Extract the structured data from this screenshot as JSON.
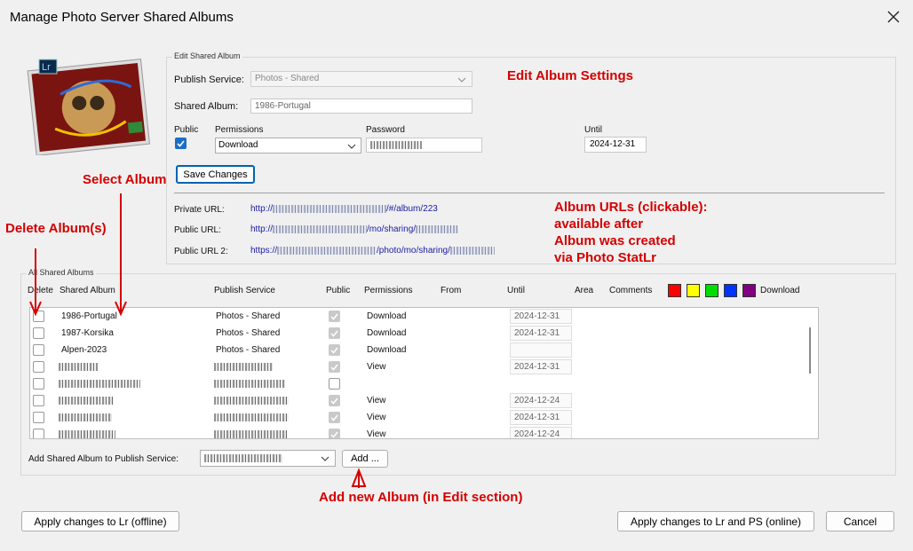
{
  "window": {
    "title": "Manage Photo Server Shared Albums"
  },
  "edit": {
    "legend": "Edit Shared Album",
    "publish_service_label": "Publish Service:",
    "publish_service_value": "Photos - Shared",
    "shared_album_label": "Shared Album:",
    "shared_album_value": "1986-Portugal",
    "public_label": "Public",
    "permissions_label": "Permissions",
    "permissions_value": "Download",
    "password_label": "Password",
    "until_label": "Until",
    "until_value": "2024-12-31",
    "save_label": "Save Changes",
    "private_url_label": "Private URL:",
    "private_url_prefix": "http://",
    "private_url_suffix": "/#/album/223",
    "public_url_label": "Public URL:",
    "public_url_prefix": "http://",
    "public_url_mid": "/mo/sharing/",
    "public_url2_label": "Public URL 2:",
    "public_url2_prefix": "https://",
    "public_url2_mid": "/photo/mo/sharing/"
  },
  "list": {
    "legend": "All Shared Albums",
    "headers": {
      "delete": "Delete",
      "album": "Shared Album",
      "service": "Publish Service",
      "public": "Public",
      "permissions": "Permissions",
      "from": "From",
      "until": "Until",
      "area": "Area",
      "comments": "Comments",
      "download": "Download"
    },
    "colors": [
      "#ff0000",
      "#ffff00",
      "#00dd00",
      "#0033ff",
      "#800080"
    ],
    "rows": [
      {
        "album": "1986-Portugal",
        "service": "Photos - Shared",
        "public": true,
        "permissions": "Download",
        "until": "2024-12-31"
      },
      {
        "album": "1987-Korsika",
        "service": "Photos - Shared",
        "public": true,
        "permissions": "Download",
        "until": "2024-12-31"
      },
      {
        "album": "Alpen-2023",
        "service": "Photos - Shared",
        "public": true,
        "permissions": "Download",
        "until": ""
      },
      {
        "album": "",
        "service": "",
        "public": true,
        "permissions": "View",
        "until": "2024-12-31"
      },
      {
        "album": "",
        "service": "",
        "public": false,
        "permissions": "",
        "until": ""
      },
      {
        "album": "",
        "service": "",
        "public": true,
        "permissions": "View",
        "until": "2024-12-24"
      },
      {
        "album": "",
        "service": "",
        "public": true,
        "permissions": "View",
        "until": "2024-12-31"
      },
      {
        "album": "",
        "service": "",
        "public": true,
        "permissions": "View",
        "until": "2024-12-24"
      }
    ],
    "add_label": "Add Shared Album to Publish Service:",
    "add_button": "Add ..."
  },
  "footer": {
    "apply_offline": "Apply changes to Lr (offline)",
    "apply_online": "Apply changes to Lr and PS (online)",
    "cancel": "Cancel"
  },
  "annotations": {
    "edit_settings": "Edit Album Settings",
    "select_album": "Select Album",
    "delete_albums": "Delete Album(s)",
    "urls_1": "Album URLs (clickable):",
    "urls_2": "available after",
    "urls_3": "Album was created",
    "urls_4": "via Photo StatLr",
    "add_new": "Add new Album (in Edit section)"
  },
  "logo": {
    "text": "Lr"
  }
}
